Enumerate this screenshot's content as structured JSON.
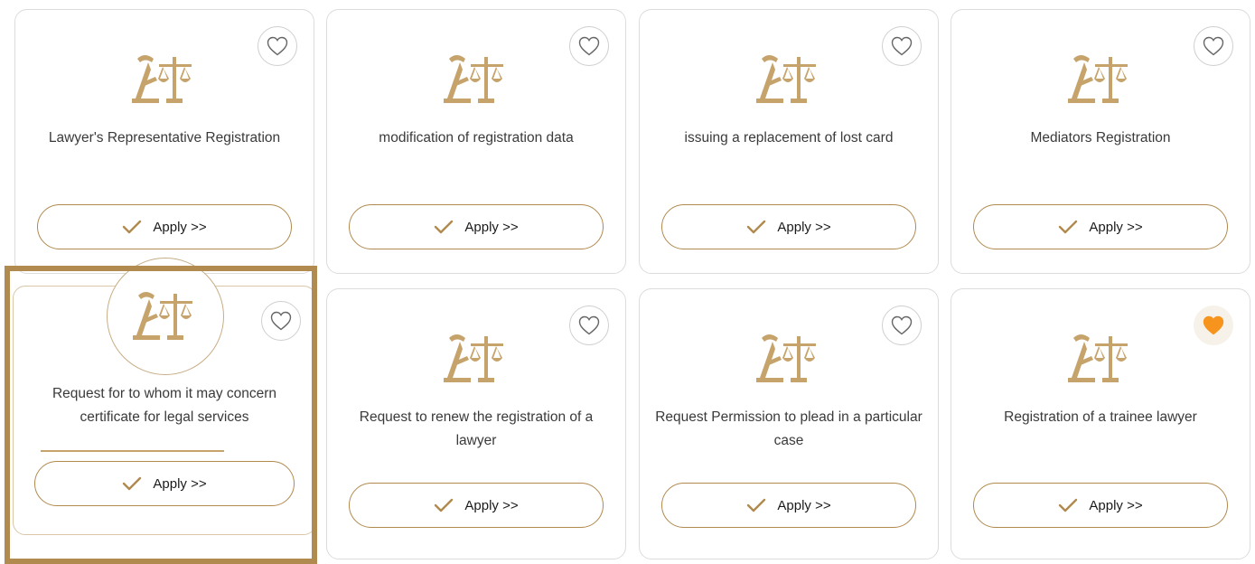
{
  "services": [
    {
      "title": "Lawyer's Representative Registration",
      "apply_label": "Apply >>",
      "favorite": false
    },
    {
      "title": "modification of registration data",
      "apply_label": "Apply >>",
      "favorite": false
    },
    {
      "title": "issuing a replacement of lost card",
      "apply_label": "Apply >>",
      "favorite": false
    },
    {
      "title": "Mediators Registration",
      "apply_label": "Apply >>",
      "favorite": false
    },
    {
      "title": "Request for to whom it may concern certificate for legal services",
      "apply_label": "Apply >>",
      "favorite": false
    },
    {
      "title": "Request to renew the registration of a lawyer",
      "apply_label": "Apply >>",
      "favorite": false
    },
    {
      "title": "Request Permission to plead in a particular case",
      "apply_label": "Apply >>",
      "favorite": false
    },
    {
      "title": "Registration of a trainee lawyer",
      "apply_label": "Apply >>",
      "favorite": true
    }
  ],
  "icons": {
    "service": "lawyer-scales-icon",
    "favorite": "heart-icon",
    "apply": "checkmark-icon"
  },
  "colors": {
    "brand_gold": "#b08a4e",
    "favorite_active": "#f7941d",
    "card_border": "#dcdcdc"
  }
}
